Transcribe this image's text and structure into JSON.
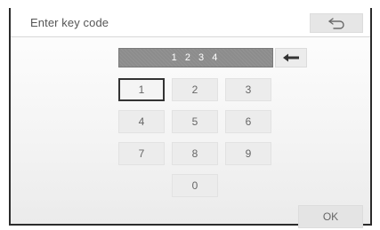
{
  "header": {
    "title": "Enter key code",
    "back_icon": "return-arrow-icon"
  },
  "display": {
    "code": "1 2 3 4"
  },
  "backspace": {
    "icon": "left-arrow-icon"
  },
  "keypad": {
    "keys": [
      "1",
      "2",
      "3",
      "4",
      "5",
      "6",
      "7",
      "8",
      "9",
      "0"
    ],
    "selected_key": "1"
  },
  "footer": {
    "ok_label": "OK"
  },
  "colors": {
    "display_bg": "#8c8c8c",
    "key_bg": "#ececec",
    "selected_border": "#333333"
  }
}
